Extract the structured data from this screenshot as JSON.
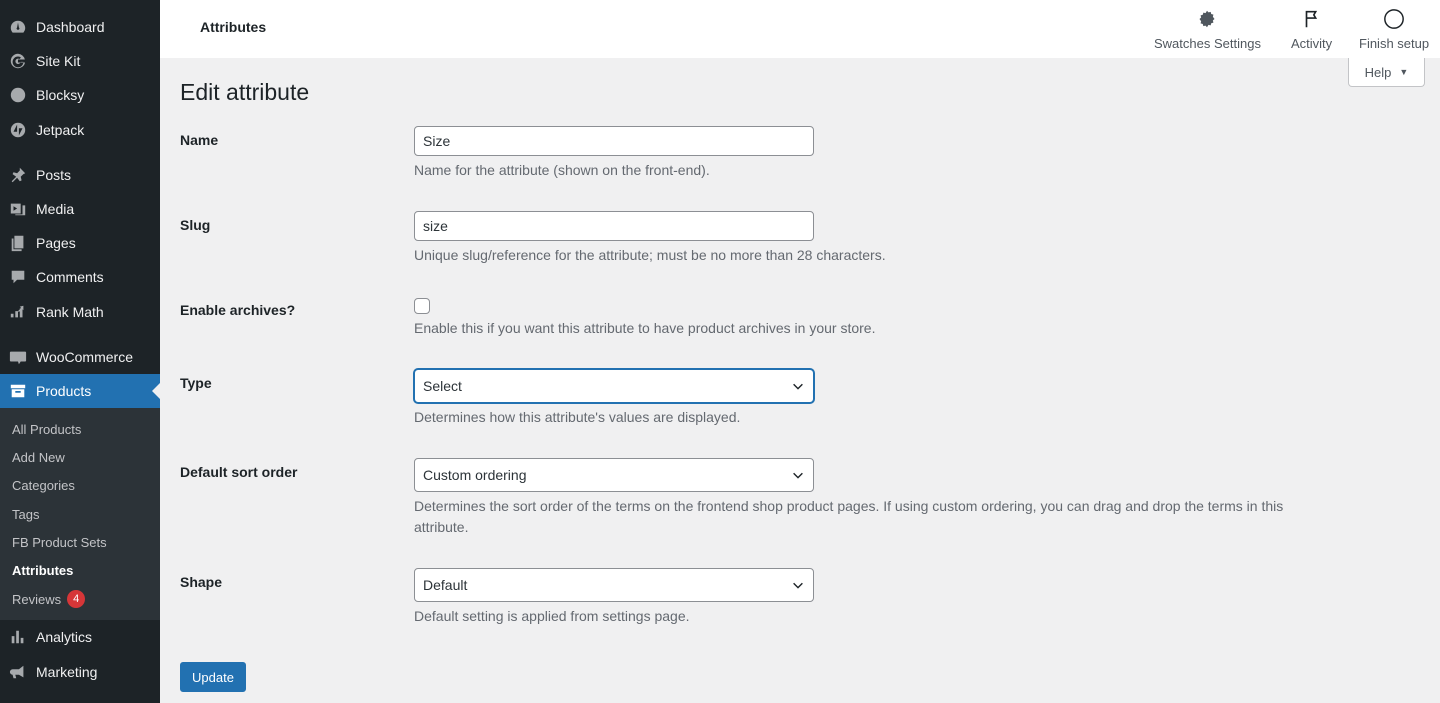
{
  "sidebar": {
    "items": [
      {
        "label": "Dashboard",
        "icon": "dashboard-icon"
      },
      {
        "label": "Site Kit",
        "icon": "google-g-icon"
      },
      {
        "label": "Blocksy",
        "icon": "blocksy-icon"
      },
      {
        "label": "Jetpack",
        "icon": "jetpack-icon"
      },
      {
        "label": "Posts",
        "icon": "pin-icon"
      },
      {
        "label": "Media",
        "icon": "media-icon"
      },
      {
        "label": "Pages",
        "icon": "pages-icon"
      },
      {
        "label": "Comments",
        "icon": "comment-icon"
      },
      {
        "label": "Rank Math",
        "icon": "rank-math-icon"
      },
      {
        "label": "WooCommerce",
        "icon": "woo-icon"
      },
      {
        "label": "Products",
        "icon": "archive-icon"
      },
      {
        "label": "Analytics",
        "icon": "bar-chart-icon"
      },
      {
        "label": "Marketing",
        "icon": "megaphone-icon"
      }
    ],
    "submenu": [
      {
        "label": "All Products"
      },
      {
        "label": "Add New"
      },
      {
        "label": "Categories"
      },
      {
        "label": "Tags"
      },
      {
        "label": "FB Product Sets"
      },
      {
        "label": "Attributes"
      },
      {
        "label": "Reviews",
        "badge": "4"
      }
    ]
  },
  "topbar": {
    "title": "Attributes",
    "actions": [
      {
        "label": "Swatches Settings",
        "icon": "gear-icon"
      },
      {
        "label": "Activity",
        "icon": "flag-icon"
      },
      {
        "label": "Finish setup",
        "icon": "circle-icon"
      }
    ],
    "help_label": "Help"
  },
  "form": {
    "title": "Edit attribute",
    "name": {
      "label": "Name",
      "value": "Size",
      "description": "Name for the attribute (shown on the front-end)."
    },
    "slug": {
      "label": "Slug",
      "value": "size",
      "description": "Unique slug/reference for the attribute; must be no more than 28 characters."
    },
    "archives": {
      "label": "Enable archives?",
      "checked": false,
      "description": "Enable this if you want this attribute to have product archives in your store."
    },
    "type": {
      "label": "Type",
      "value": "Select",
      "description": "Determines how this attribute's values are displayed."
    },
    "sort": {
      "label": "Default sort order",
      "value": "Custom ordering",
      "description": "Determines the sort order of the terms on the frontend shop product pages. If using custom ordering, you can drag and drop the terms in this attribute."
    },
    "shape": {
      "label": "Shape",
      "value": "Default",
      "description": "Default setting is applied from settings page."
    },
    "update_label": "Update"
  },
  "colors": {
    "accent": "#2271b1",
    "sidebar_bg": "#1d2327",
    "badge": "#d63638"
  }
}
